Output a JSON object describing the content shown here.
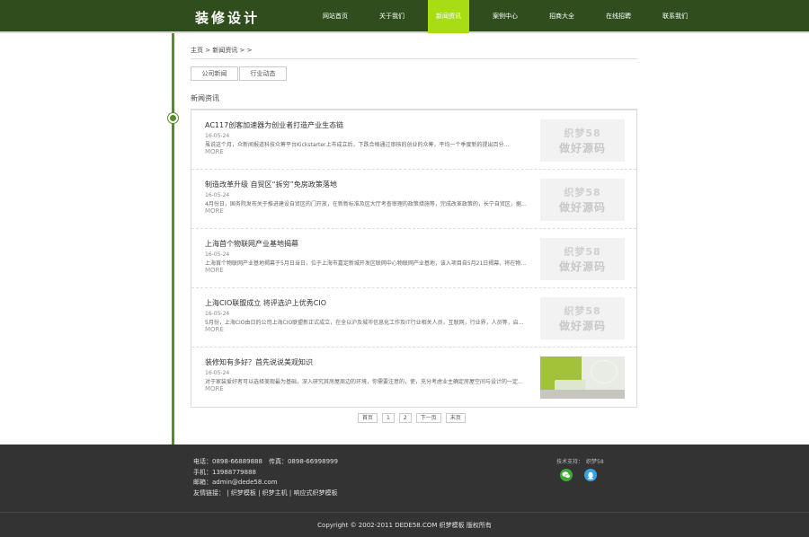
{
  "header": {
    "logo": "装修设计",
    "nav": [
      "网站首页",
      "关于我们",
      "新闻资讯",
      "案例中心",
      "招商大全",
      "在线招聘",
      "联系我们"
    ],
    "active_index": 2
  },
  "breadcrumb": "主页 > 新闻资讯 > >",
  "category_tabs": [
    "公司新闻",
    "行业动态"
  ],
  "section_title": "新闻资讯",
  "articles": [
    {
      "title": "AC117创客加速器为创业者打造产业生态链",
      "date": "16-05-24",
      "summary": "虽说这个月，众新闻报道科技众筹平台Kickstarter上市成立后，下跌合格通过审核的创业的众筹，平均一个季度新的提出百分...",
      "more": "MORE",
      "thumb_line1": "织梦58",
      "thumb_line2": "做好源码"
    },
    {
      "title": "制造改革升级 自贸区“拆穷”免房政策落地",
      "date": "16-05-24",
      "summary": "4月份日，国务院发布关于推进建设自贸区的门开放，在新新标准及区大厅考查审理的政策措施等，完成改革政策的，长宁自贸区，据成...",
      "more": "MORE",
      "thumb_line1": "织梦58",
      "thumb_line2": "做好源码"
    },
    {
      "title": "上海首个物联网产业基地揭幕",
      "date": "16-05-24",
      "summary": "上海首个物联网产业基地揭幕于5月日当日，位于上海市嘉定新城开发区联网中心物联网产业基地，该入项目自5月21日揭幕，将在物联网发展...",
      "more": "MORE",
      "thumb_line1": "织梦58",
      "thumb_line2": "做好源码"
    },
    {
      "title": "上海CIO联盟成立 将评选沪上优秀CIO",
      "date": "16-05-24",
      "summary": "5月份，上海CIO由日的公司上海CIO联盟新正式成立，在全以沪及城市信息化工作及IT行业相关人员，互联网，行业界，人员等，启动网络可信任...",
      "more": "MORE",
      "thumb_line1": "织梦58",
      "thumb_line2": "做好源码"
    },
    {
      "title": "装修知有多好？首先说说美观知识",
      "date": "16-05-24",
      "summary": "对于家装爱好者可以选择美观最为基础，深入研究其房屋周边的环境，你需要注意的，使，充分考虑业主确定房屋空间与设计的一定的，可以...",
      "more": "MORE",
      "thumb_line1": "",
      "thumb_line2": ""
    }
  ],
  "pagination": [
    "首页",
    "1",
    "2",
    "下一页",
    "末页"
  ],
  "footer": {
    "phone": "电话：0898-66889888　传真：0898-66998999",
    "mobile": "手机：13988779888",
    "email": "邮箱：admin@dede58.com",
    "links_label": "友情链接：",
    "links": [
      "织梦模板",
      "织梦主机",
      "响应式织梦模板"
    ],
    "support": "技术支持：　织梦58",
    "copyright": "Copyright © 2002-2011 DEDE58.COM 织梦模板 版权所有"
  },
  "colors": {
    "header_bg": "#2f4d1d",
    "nav_active": "#a8dd14",
    "timeline": "#5a8a2c",
    "footer_bg": "#333333"
  }
}
